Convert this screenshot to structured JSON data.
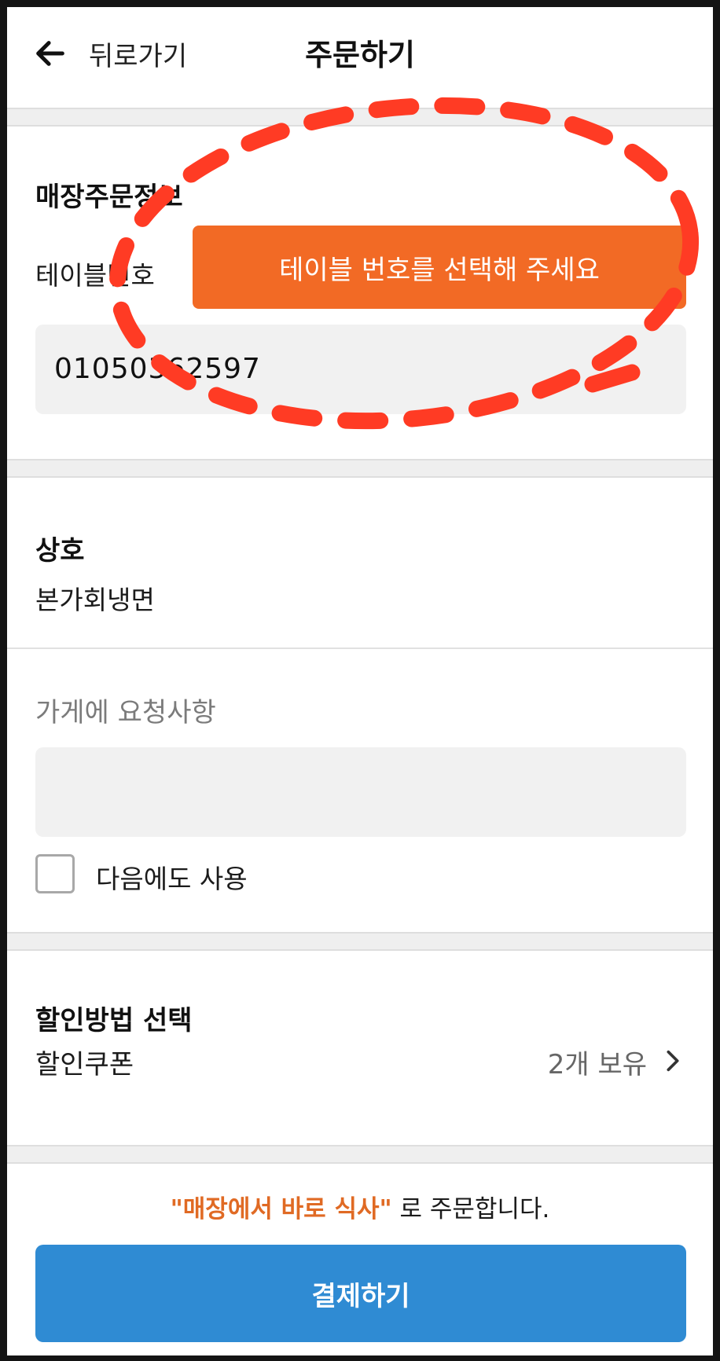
{
  "header": {
    "back_label": "뒤로가기",
    "title": "주문하기",
    "back_icon": "arrow-left-icon"
  },
  "store_order_info": {
    "section_title": "매장주문정보",
    "table_label": "테이블번호",
    "table_button_label": "테이블 번호를 선택해 주세요",
    "phone_value": "01050362597"
  },
  "business": {
    "section_title": "상호",
    "name": "본가회냉면"
  },
  "request": {
    "label": "가게에 요청사항",
    "value": "",
    "save_next_label": "다음에도 사용",
    "save_next_checked": false
  },
  "discount": {
    "section_title": "할인방법 선택",
    "coupon_label": "할인쿠폰",
    "coupon_count": "2개 보유",
    "chevron_icon": "chevron-right-icon"
  },
  "footer": {
    "notice_accent": "\"매장에서 바로 식사\"",
    "notice_rest": " 로 주문합니다.",
    "pay_button_label": "결제하기"
  },
  "colors": {
    "accent_orange": "#f26a25",
    "pay_blue": "#2f8bd3",
    "annotation_red": "#ff3b24"
  }
}
